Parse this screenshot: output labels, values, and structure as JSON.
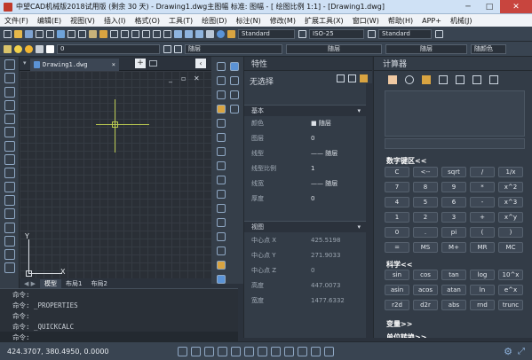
{
  "window": {
    "title": "中望CAD机械版2018试用版 (剩余 30 天) - Drawing1.dwg主图幅  标准: 图幅 - [ 绘图比例 1:1] - [Drawing1.dwg]",
    "min": "─",
    "max": "□",
    "close": "✕"
  },
  "menu": [
    "文件(F)",
    "编辑(E)",
    "视图(V)",
    "插入(I)",
    "格式(O)",
    "工具(T)",
    "绘图(D)",
    "标注(N)",
    "修改(M)",
    "扩展工具(X)",
    "窗口(W)",
    "帮助(H)",
    "APP+",
    "机械(J)"
  ],
  "toolbar1": {
    "text_style": "Standard",
    "dim_style": "ISO-25",
    "table_style": "Standard"
  },
  "toolbar2": {
    "layer": "0",
    "color": "随层",
    "linetype": "随层",
    "lineweight": "随层",
    "plot_style": "随颜色"
  },
  "document": {
    "tab": "Drawing1.dwg",
    "tab_close": "×",
    "new_tab": "+"
  },
  "canvas": {
    "win_buttons": [
      "_",
      "▫",
      "✕"
    ],
    "y_axis": "Y",
    "x_axis": "X"
  },
  "layout_tabs": [
    "模型",
    "布局1",
    "布局2"
  ],
  "command": {
    "lines": [
      "命令:",
      "命令: _PROPERTIES",
      "命令:",
      "命令: _QUICKCALC",
      "命令:"
    ]
  },
  "properties": {
    "title": "特性",
    "selection": "无选择",
    "basic_label": "基本",
    "basic": [
      {
        "k": "颜色",
        "v": "■ 随层"
      },
      {
        "k": "图层",
        "v": "0"
      },
      {
        "k": "线型",
        "v": "—— 随层"
      },
      {
        "k": "线型比例",
        "v": "1"
      },
      {
        "k": "线宽",
        "v": "—— 随层"
      },
      {
        "k": "厚度",
        "v": "0"
      }
    ],
    "view_label": "视图",
    "view": [
      {
        "k": "中心点 X",
        "v": "425.5198"
      },
      {
        "k": "中心点 Y",
        "v": "271.9033"
      },
      {
        "k": "中心点 Z",
        "v": "0"
      },
      {
        "k": "高度",
        "v": "447.0073"
      },
      {
        "k": "宽度",
        "v": "1477.6332"
      }
    ]
  },
  "calculator": {
    "title": "计算器",
    "numpad_label": "数字键区<<",
    "numpad": [
      [
        "C",
        "<--",
        "sqrt",
        "/",
        "1/x"
      ],
      [
        "7",
        "8",
        "9",
        "*",
        "x^2"
      ],
      [
        "4",
        "5",
        "6",
        "-",
        "x^3"
      ],
      [
        "1",
        "2",
        "3",
        "+",
        "x^y"
      ],
      [
        "0",
        ".",
        "pi",
        "(",
        ")"
      ],
      [
        "=",
        "MS",
        "M+",
        "MR",
        "MC"
      ]
    ],
    "sci_label": "科学<<",
    "sci": [
      [
        "sin",
        "cos",
        "tan",
        "log",
        "10^x"
      ],
      [
        "asin",
        "acos",
        "atan",
        "ln",
        "e^x"
      ],
      [
        "r2d",
        "d2r",
        "abs",
        "rnd",
        "trunc"
      ]
    ],
    "vars_label": "变量>>",
    "units_label": "单位转换>>"
  },
  "status": {
    "coords": "424.3707, 380.4950, 0.0000",
    "ortho": "⊾",
    "settings": "⚙"
  },
  "colors": {
    "accent": "#b9c850",
    "panel": "#333c47",
    "canvas": "#2a2f36",
    "close": "#c8453e"
  }
}
